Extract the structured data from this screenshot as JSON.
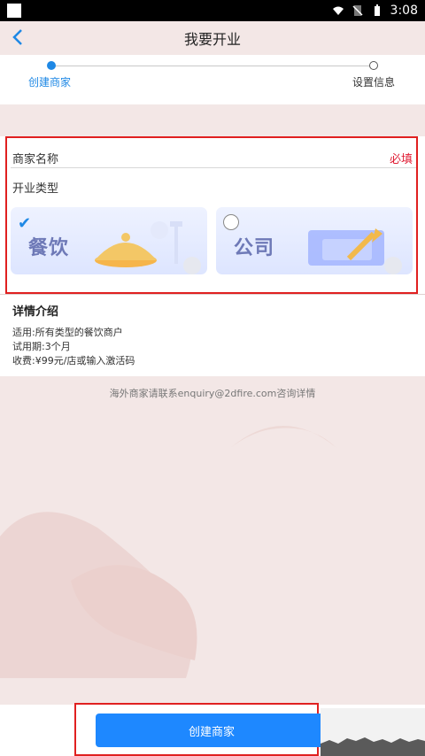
{
  "status": {
    "time": "3:08"
  },
  "appbar": {
    "title": "我要开业"
  },
  "steps": [
    {
      "label": "创建商家"
    },
    {
      "label": "设置信息"
    }
  ],
  "form": {
    "merchant_name_label": "商家名称",
    "required_label": "必填",
    "business_type_label": "开业类型",
    "types": [
      {
        "label": "餐饮",
        "selected": true
      },
      {
        "label": "公司",
        "selected": false
      }
    ]
  },
  "details": {
    "title": "详情介绍",
    "lines": [
      "适用:所有类型的餐饮商户",
      "试用期:3个月",
      "收费:¥99元/店或输入激活码"
    ]
  },
  "contact_note": "海外商家请联系enquiry@2dfire.com咨询详情",
  "bottom": {
    "button_label": "创建商家"
  }
}
